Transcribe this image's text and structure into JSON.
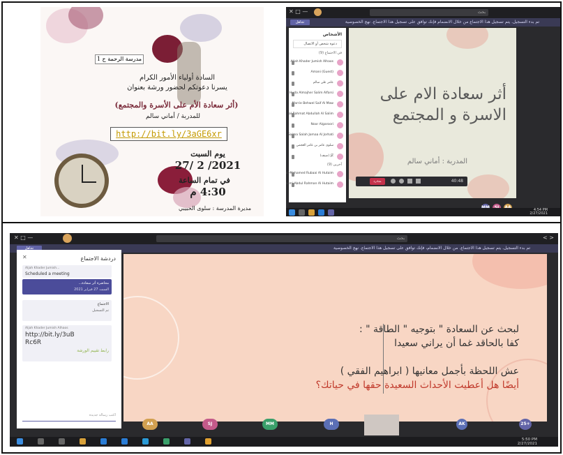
{
  "invitation": {
    "school": "مدرسة الرحمة ح 1",
    "greeting": "السادة أولياء الأمور الكرام",
    "invite_line": "يسرنا دعوتكم لحضور ورشة بعنوان",
    "workshop_title": "(أثر سعادة الأم على الأسرة والمجتمع)",
    "presenter": "للمدربة / أماني سالم",
    "link": "http://bit.ly/3aGE6xr",
    "day_label": "يوم السبت",
    "date": "27/ 2 /2021",
    "time_label": "في تمام الساعة",
    "time": "4:30 م",
    "principal": "مديرة المدرسة : سلوى الحبيبي"
  },
  "teams_top": {
    "search": "بحث",
    "notice": "تم بدء التسجيل. يتم تسجيل هذا الاجتماع من خلال الانضمام فإنك توافق على تسجيل هذا الاجتماع. نهج الخصوصية",
    "notice_button": "تجاهل",
    "panel_title": "الأشخاص",
    "invite_label": "دعوة شخص أو الاتصال",
    "section_in_meeting": "في الاجتماع (9)",
    "participants": [
      "Aljah Khader Jumish Alhaos",
      "Amani (Guest)",
      "عامر علي سالم",
      "Huda Almajher Salim Alfarsi",
      "Marrie Behwel Saif Al Maw",
      "al-Rahmat Abdullah Al Salim",
      "Noor Algaroori",
      "Salma Salah Jomaa Al Jorhati",
      "سلوى عامر بن عامر العجمي",
      "JZ (ضيف)",
      "al-Mohamed Rubaai Al Hutaim",
      "Jasmi Abdul Rahman Al Hutaim"
    ],
    "section_others": "آخرين (9)",
    "slide_title": "أثر سعادة الام على الاسرة و المجتمع",
    "slide_presenter": "المدربة : أماني سالم",
    "leave_label": "مغادرة",
    "call_time": "40:48",
    "tiles": [
      "MM",
      "SJ",
      "AA"
    ],
    "clock_time": "4:54 PM",
    "clock_date": "2/27/2021"
  },
  "teams_bottom": {
    "search": "بحث",
    "notice": "تم بدء التسجيل. يتم تسجيل هذا الاجتماع. من خلال الانضمام، فإنك توافق على تسجيل هذا الاجتماع. نهج الخصوصية",
    "notice_button": "تجاهل",
    "chat_title": "دردشة الاجتماع",
    "chat_messages": [
      {
        "meta": "Aljah Khader Jumish...",
        "text": "Scheduled a meeting"
      },
      {
        "meta": "محاضرة أثر سعادة...",
        "text": "السبت 27 فبراير 2021"
      },
      {
        "meta": "الاجتماع",
        "text": "تم التسجيل"
      },
      {
        "meta": "Aljah Khader Jumish Alhaos",
        "text": "http://bit.ly/3uBRc6R",
        "extra": "رابط تقييم الورشة"
      }
    ],
    "chat_input": "اكتب رسالة جديدة",
    "slide_lines": [
      "لبحث عن السعادة \" بتوجيه \" الطاقة \" :",
      "كفا بالحاقد غما أن يراني سعيدا",
      "عش اللحظة بأجمل معانيها ( ابراهيم الفقي )",
      "أيضًا هل أعطيت الأحداث السعيدة حقها في حياتك؟"
    ],
    "tiles": [
      "AA",
      "SJ",
      "MM",
      "H",
      "AK",
      "25+"
    ],
    "clock_time": "5:50 PM",
    "clock_date": "2/27/2021"
  }
}
